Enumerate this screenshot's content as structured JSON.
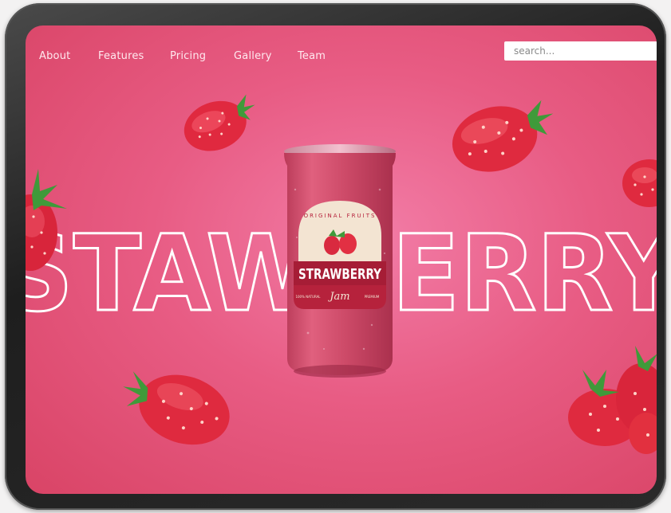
{
  "nav": {
    "items": [
      "About",
      "Features",
      "Pricing",
      "Gallery",
      "Team"
    ]
  },
  "search": {
    "placeholder": "search..."
  },
  "hero": {
    "headline": "STAWBERRY"
  },
  "can": {
    "arc_text": "ORIGINAL FRUITS",
    "title": "STRAWBERRY",
    "script": "Jam",
    "left_small": "100% NATURAL",
    "right_small": "PREMIUM"
  },
  "colors": {
    "background": "#e85c84",
    "can": "#d9506e",
    "label_cream": "#f3e4d2",
    "label_red": "#b6223c",
    "text_light": "#ffffff"
  }
}
